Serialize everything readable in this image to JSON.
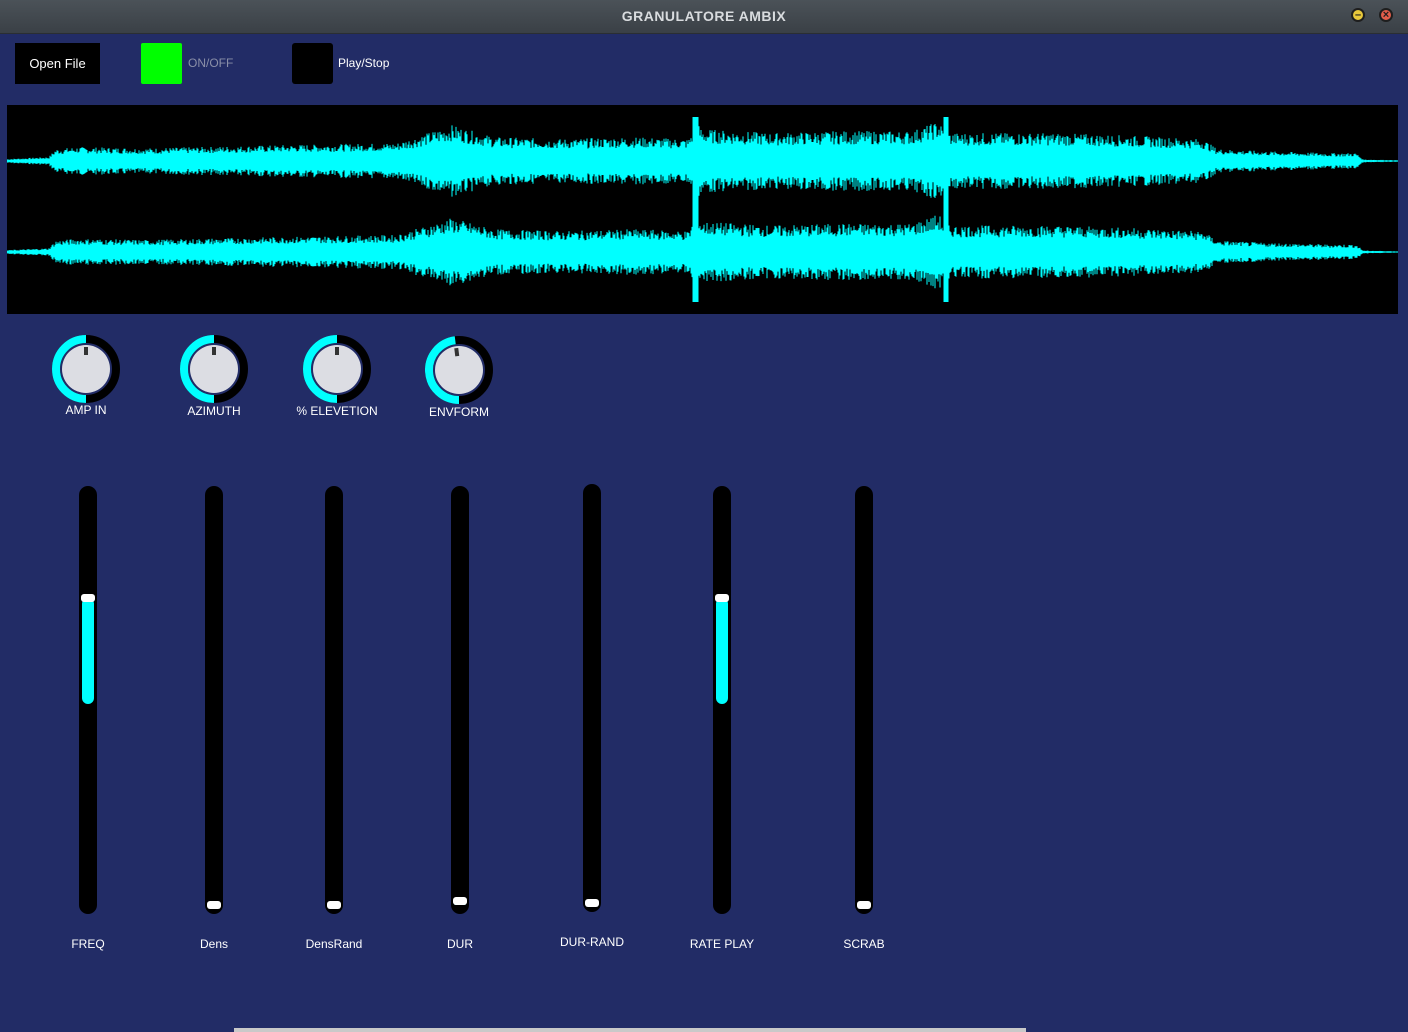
{
  "window": {
    "title": "GRANULATORE AMBIX"
  },
  "toolbar": {
    "open_file_label": "Open File",
    "onoff_label": "ON/OFF",
    "onoff_state": "on",
    "play_label": "Play/Stop",
    "play_state": "off"
  },
  "knobs": [
    {
      "label": "AMP IN",
      "value": 0.5
    },
    {
      "label": "AZIMUTH",
      "value": 0.5
    },
    {
      "label": "% ELEVETION",
      "value": 0.5
    },
    {
      "label": "ENVFORM",
      "value": 0.48
    }
  ],
  "sliders": [
    {
      "label": "FREQ",
      "low": 0.49,
      "high": 0.75
    },
    {
      "label": "Dens",
      "low": 0.0,
      "high": 0.0
    },
    {
      "label": "DensRand",
      "low": 0.0,
      "high": 0.0
    },
    {
      "label": "DUR",
      "low": 0.0,
      "high": 0.01
    },
    {
      "label": "DUR-RAND",
      "low": 0.0,
      "high": 0.0
    },
    {
      "label": "RATE PLAY",
      "low": 0.49,
      "high": 0.75
    },
    {
      "label": "SCRAB",
      "low": 0.0,
      "high": 0.0
    }
  ],
  "colors": {
    "background": "#222c66",
    "accent": "#00ffff",
    "onoff_active": "#00ff00"
  }
}
